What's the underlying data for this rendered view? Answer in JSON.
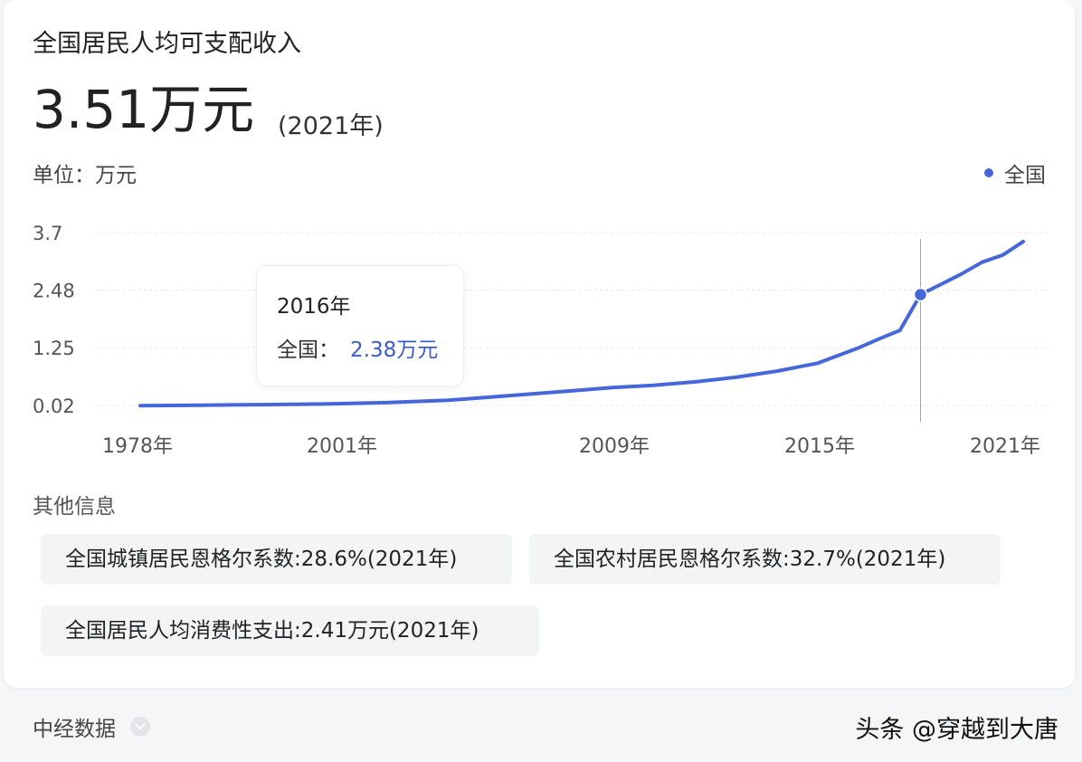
{
  "header": {
    "title": "全国居民人均可支配收入",
    "big_value": "3.51万元",
    "big_year": "(2021年)",
    "unit": "单位：万元",
    "legend_label": "全国"
  },
  "colors": {
    "series": "#4567d9",
    "grid": "#e6e8ee",
    "axis_text": "#555555"
  },
  "tooltip": {
    "year": "2016年",
    "label": "全国：",
    "value": "2.38万元"
  },
  "chart_data": {
    "type": "line",
    "title": "",
    "xlabel": "",
    "ylabel": "",
    "x_tick_labels": [
      "1978年",
      "2001年",
      "2009年",
      "2015年",
      "2021年"
    ],
    "y_tick_labels": [
      "3.7",
      "2.48",
      "1.25",
      "0.02"
    ],
    "y_ticks": [
      3.7,
      2.48,
      1.25,
      0.02
    ],
    "ylim": [
      0.02,
      3.7
    ],
    "x_range": [
      1978,
      2021
    ],
    "grid": true,
    "legend": "top-right",
    "highlight": {
      "x": 2016,
      "y": 2.38
    },
    "series": [
      {
        "name": "全国",
        "points": [
          [
            1978,
            0.017
          ],
          [
            1981,
            0.025
          ],
          [
            1984,
            0.038
          ],
          [
            1987,
            0.05
          ],
          [
            1990,
            0.08
          ],
          [
            1993,
            0.13
          ],
          [
            1996,
            0.23
          ],
          [
            1999,
            0.33
          ],
          [
            2001,
            0.4
          ],
          [
            2003,
            0.45
          ],
          [
            2005,
            0.52
          ],
          [
            2007,
            0.62
          ],
          [
            2009,
            0.75
          ],
          [
            2011,
            0.92
          ],
          [
            2013,
            1.25
          ],
          [
            2014,
            1.44
          ],
          [
            2015,
            1.62
          ],
          [
            2016,
            2.38
          ],
          [
            2017,
            2.6
          ],
          [
            2018,
            2.82
          ],
          [
            2019,
            3.07
          ],
          [
            2020,
            3.22
          ],
          [
            2021,
            3.51
          ]
        ]
      }
    ]
  },
  "other_info": {
    "title": "其他信息",
    "items": [
      "全国城镇居民恩格尔系数:28.6%(2021年)",
      "全国农村居民恩格尔系数:32.7%(2021年)",
      "全国居民人均消费性支出:2.41万元(2021年)"
    ]
  },
  "footer": {
    "source": "中经数据",
    "watermark": "头条 @穿越到大唐"
  }
}
